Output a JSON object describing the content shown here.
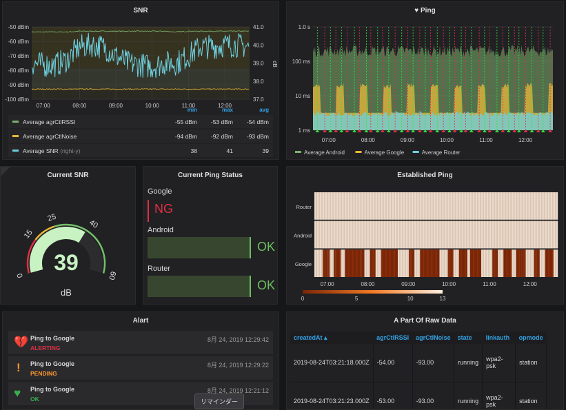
{
  "colors": {
    "rssi": "#7eb26d",
    "noise": "#eab839",
    "snr": "#6ed0e0",
    "android": "#7eb26d",
    "google": "#eab839",
    "router": "#6ed0e0",
    "red": "#e02f44",
    "green": "#56a64b",
    "orange": "#ff9830"
  },
  "snr_panel": {
    "title": "SNR",
    "chart_data": {
      "type": "line",
      "left_ticks": [
        "-50 dBm",
        "-60 dBm",
        "-70 dBm",
        "-80 dBm",
        "-90 dBm",
        "-100 dBm"
      ],
      "right_ticks": [
        "41.0",
        "40.0",
        "39.0",
        "38.0",
        "37.0"
      ],
      "ylabel_right": "dB",
      "x_ticks": [
        "07:00",
        "08:00",
        "09:00",
        "10:00",
        "11:00",
        "12:00"
      ],
      "ylim_left": [
        -100,
        -50
      ],
      "ylim_right": [
        37,
        41
      ],
      "x": [
        "06:40",
        "07:00",
        "07:20",
        "07:40",
        "08:00",
        "08:20",
        "08:40",
        "09:00",
        "09:20",
        "09:40",
        "10:00",
        "10:20",
        "10:40",
        "11:00",
        "11:20",
        "11:40",
        "12:00",
        "12:20",
        "12:40"
      ],
      "series": [
        {
          "name": "Average agrCtlRSSI",
          "values": [
            -53.5,
            -53.5,
            -53.5,
            -53.5,
            -53,
            -53,
            -53,
            -53,
            -53,
            -53,
            -53,
            -53,
            -53.5,
            -53,
            -53,
            -53,
            -53,
            -53,
            -53
          ]
        },
        {
          "name": "Average agrCtlNoise",
          "values": [
            -93,
            -93,
            -93,
            -93,
            -93,
            -93,
            -93,
            -93,
            -93,
            -93,
            -93,
            -93,
            -93,
            -93,
            -93,
            -93,
            -93,
            -93,
            -93
          ]
        },
        {
          "name": "Average SNR",
          "values": [
            39,
            38.9,
            38.9,
            39.2,
            39.9,
            40,
            39.9,
            39.4,
            39,
            38.9,
            38.8,
            39,
            39,
            39.4,
            39.9,
            39.9,
            40,
            40,
            39.9
          ]
        }
      ]
    },
    "legend": {
      "headers": [
        "min",
        "max",
        "avg"
      ],
      "rows": [
        {
          "name": "Average agrCtlRSSI",
          "suffix": "",
          "min": "-55 dBm",
          "max": "-53 dBm",
          "avg": "-54 dBm"
        },
        {
          "name": "Average agrCtlNoise",
          "suffix": "",
          "min": "-94 dBm",
          "max": "-92 dBm",
          "avg": "-93 dBm"
        },
        {
          "name": "Average SNR",
          "suffix": "(right-y)",
          "min": "38",
          "max": "41",
          "avg": "39"
        }
      ]
    }
  },
  "ping_panel": {
    "title": "Ping",
    "icon": "heart-icon",
    "chart_data": {
      "type": "area",
      "scale": "log",
      "y_ticks": [
        "1.0 s",
        "100 ms",
        "10 ms",
        "1 ms"
      ],
      "x_ticks": [
        "07:00",
        "08:00",
        "09:00",
        "10:00",
        "11:00",
        "12:00"
      ],
      "series": [
        {
          "name": "Average Android",
          "value_ms": 200
        },
        {
          "name": "Average Google",
          "value_ms": 20
        },
        {
          "name": "Average Router",
          "value_ms": 3
        }
      ]
    }
  },
  "gauge": {
    "title": "Current SNR",
    "value": "39",
    "unit": "dB",
    "min": 0,
    "max": 60,
    "thresholds": [
      15,
      25,
      40
    ],
    "tick_labels": [
      "0",
      "15",
      "25",
      "40",
      "60"
    ]
  },
  "ping_status": {
    "title": "Current Ping Status",
    "items": [
      {
        "name": "Google",
        "status": "NG"
      },
      {
        "name": "Android",
        "status": "OK"
      },
      {
        "name": "Router",
        "status": "OK"
      }
    ]
  },
  "heatmap": {
    "title": "Established Ping",
    "chart_data": {
      "type": "heatmap",
      "rows": [
        "Router",
        "Android",
        "Google"
      ],
      "x_ticks": [
        "07:00",
        "08:00",
        "09:00",
        "10:00",
        "11:00",
        "12:00"
      ],
      "scale_labels": [
        "0",
        "5",
        "10",
        "13"
      ],
      "range": [
        0,
        13
      ]
    }
  },
  "alerts": {
    "title": "Alart",
    "items": [
      {
        "name": "Ping to Google",
        "state": "ALERTING",
        "time": "8月 24, 2019 12:29:42"
      },
      {
        "name": "Ping to Google",
        "state": "PENDING",
        "time": "8月 24, 2019 12:29:22"
      },
      {
        "name": "Ping to Google",
        "state": "OK",
        "time": "8月 24, 2019 12:21:12"
      }
    ],
    "tooltip": "リマインダー"
  },
  "raw": {
    "title": "A Part Of Raw Data",
    "columns": [
      "createdAt ▴",
      "agrCtlRSSI",
      "agrCtlNoise",
      "state",
      "linkauth",
      "opmode"
    ],
    "rows": [
      [
        "2019-08-24T03:21:18.000Z",
        "-54.00",
        "-93.00",
        "running",
        "wpa2-psk",
        "station"
      ],
      [
        "2019-08-24T03:21:23.000Z",
        "-53.00",
        "-93.00",
        "running",
        "wpa2-psk",
        "station"
      ]
    ]
  }
}
